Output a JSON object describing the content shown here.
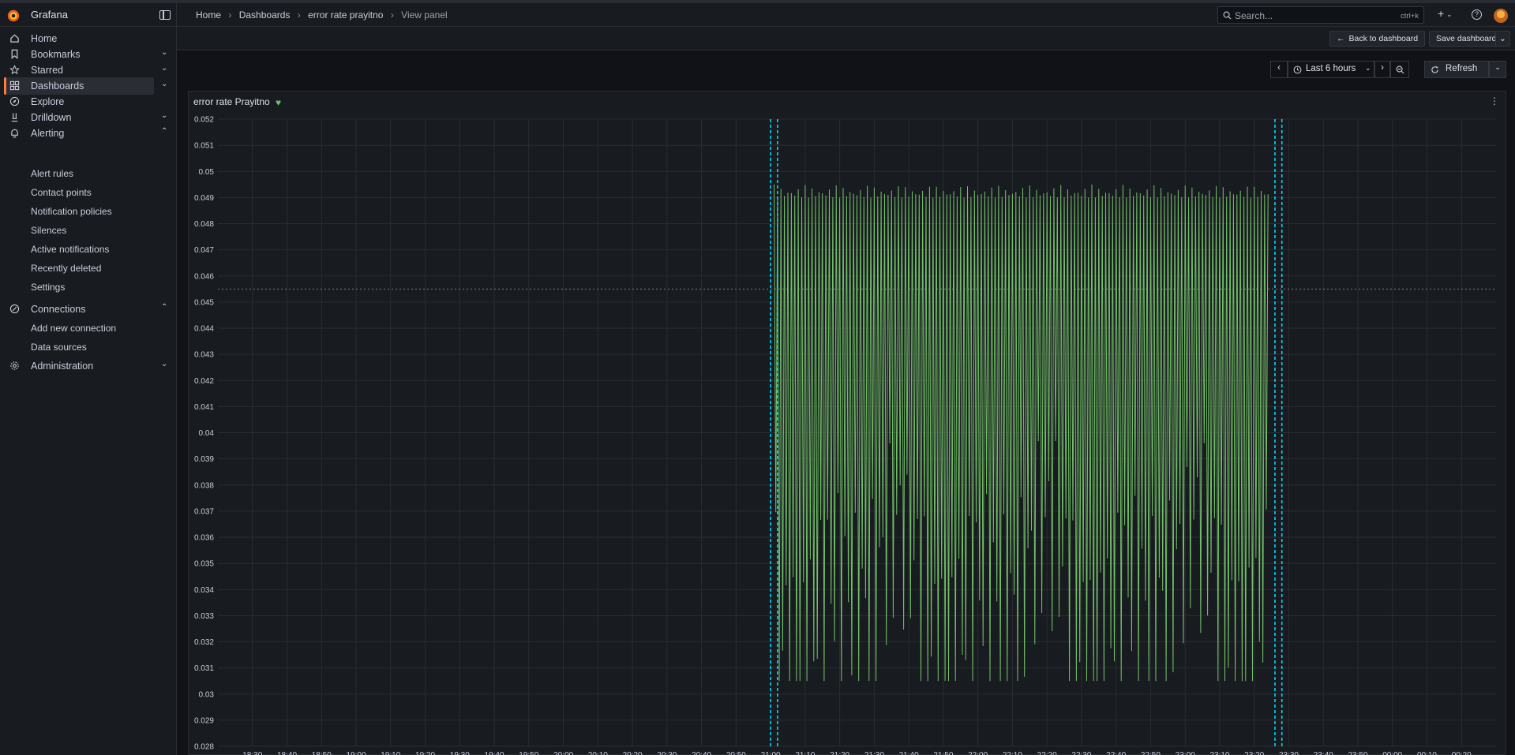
{
  "app": {
    "name": "Grafana"
  },
  "sidebar": {
    "items": [
      {
        "label": "Home",
        "icon": "home-icon",
        "chevron": ""
      },
      {
        "label": "Bookmarks",
        "icon": "bookmark-icon",
        "chevron": "⌄"
      },
      {
        "label": "Starred",
        "icon": "star-icon",
        "chevron": "⌄"
      },
      {
        "label": "Dashboards",
        "icon": "apps-icon",
        "chevron": "⌄"
      },
      {
        "label": "Explore",
        "icon": "compass-icon",
        "chevron": ""
      },
      {
        "label": "Drilldown",
        "icon": "drilldown-icon",
        "chevron": "⌄"
      },
      {
        "label": "Alerting",
        "icon": "bell-icon",
        "chevron": "⌃"
      }
    ],
    "alerting_children": [
      "Alert rules",
      "Contact points",
      "Notification policies",
      "Silences",
      "Active notifications",
      "Recently deleted",
      "Settings"
    ],
    "connections": {
      "label": "Connections",
      "icon": "connections-icon",
      "chevron": "⌃"
    },
    "connections_children": [
      "Add new connection",
      "Data sources"
    ],
    "administration": {
      "label": "Administration",
      "icon": "gear-icon",
      "chevron": "⌄"
    }
  },
  "breadcrumb": {
    "home": "Home",
    "dashboards": "Dashboards",
    "dashboard": "error rate prayitno",
    "current": "View panel",
    "sep": "›"
  },
  "search": {
    "placeholder": "Search...",
    "shortcut": "ctrl+k"
  },
  "header": {
    "plus": "+",
    "plus_chevron": "⌄",
    "help": "?"
  },
  "toolbar": {
    "back_label": "Back to dashboard",
    "back_icon": "←",
    "save_label": "Save dashboard",
    "save_chevron": "⌄"
  },
  "time": {
    "prev": "‹",
    "range_label": "Last 6 hours",
    "range_chevron": "⌄",
    "next": "›",
    "refresh_label": "Refresh",
    "refresh_chevron": "⌄"
  },
  "panel": {
    "title": "error rate Prayitno",
    "health": "♥",
    "menu": "⋮"
  },
  "colors": {
    "series": "#73bf69",
    "annotation": "#00d8ff",
    "accent": "#ff7a3d",
    "threshold": "#7f7f86"
  },
  "chart_data": {
    "type": "line",
    "title": "error rate Prayitno",
    "xlabel": "",
    "ylabel": "",
    "ylim": [
      0.028,
      0.052
    ],
    "yticks": [
      "0.052",
      "0.051",
      "0.05",
      "0.049",
      "0.048",
      "0.047",
      "0.046",
      "0.045",
      "0.044",
      "0.043",
      "0.042",
      "0.041",
      "0.04",
      "0.039",
      "0.038",
      "0.037",
      "0.036",
      "0.035",
      "0.034",
      "0.033",
      "0.032",
      "0.031",
      "0.03",
      "0.029",
      "0.028"
    ],
    "xticks": [
      "18:30",
      "18:40",
      "18:50",
      "19:00",
      "19:10",
      "19:20",
      "19:30",
      "19:40",
      "19:50",
      "20:00",
      "20:10",
      "20:20",
      "20:30",
      "20:40",
      "20:50",
      "21:00",
      "21:10",
      "21:20",
      "21:30",
      "21:40",
      "21:50",
      "22:00",
      "22:10",
      "22:20",
      "22:30",
      "22:40",
      "22:50",
      "23:00",
      "23:10",
      "23:20",
      "23:30",
      "23:40",
      "23:50",
      "00:00",
      "00:10",
      "00:20"
    ],
    "x_range_minutes_from_1830": [
      -10,
      360
    ],
    "series": [
      {
        "name": "",
        "x_start": "21:01",
        "x_end": "23:24",
        "oscillation": "alternating high/low samples every 30s",
        "highs_approx": 0.0495,
        "lows_range": [
          0.0305,
          0.0365
        ]
      }
    ],
    "threshold_line": 0.0455,
    "annotations": [
      "21:00",
      "21:02",
      "23:26",
      "23:28"
    ],
    "grid": true,
    "legend": "none"
  }
}
